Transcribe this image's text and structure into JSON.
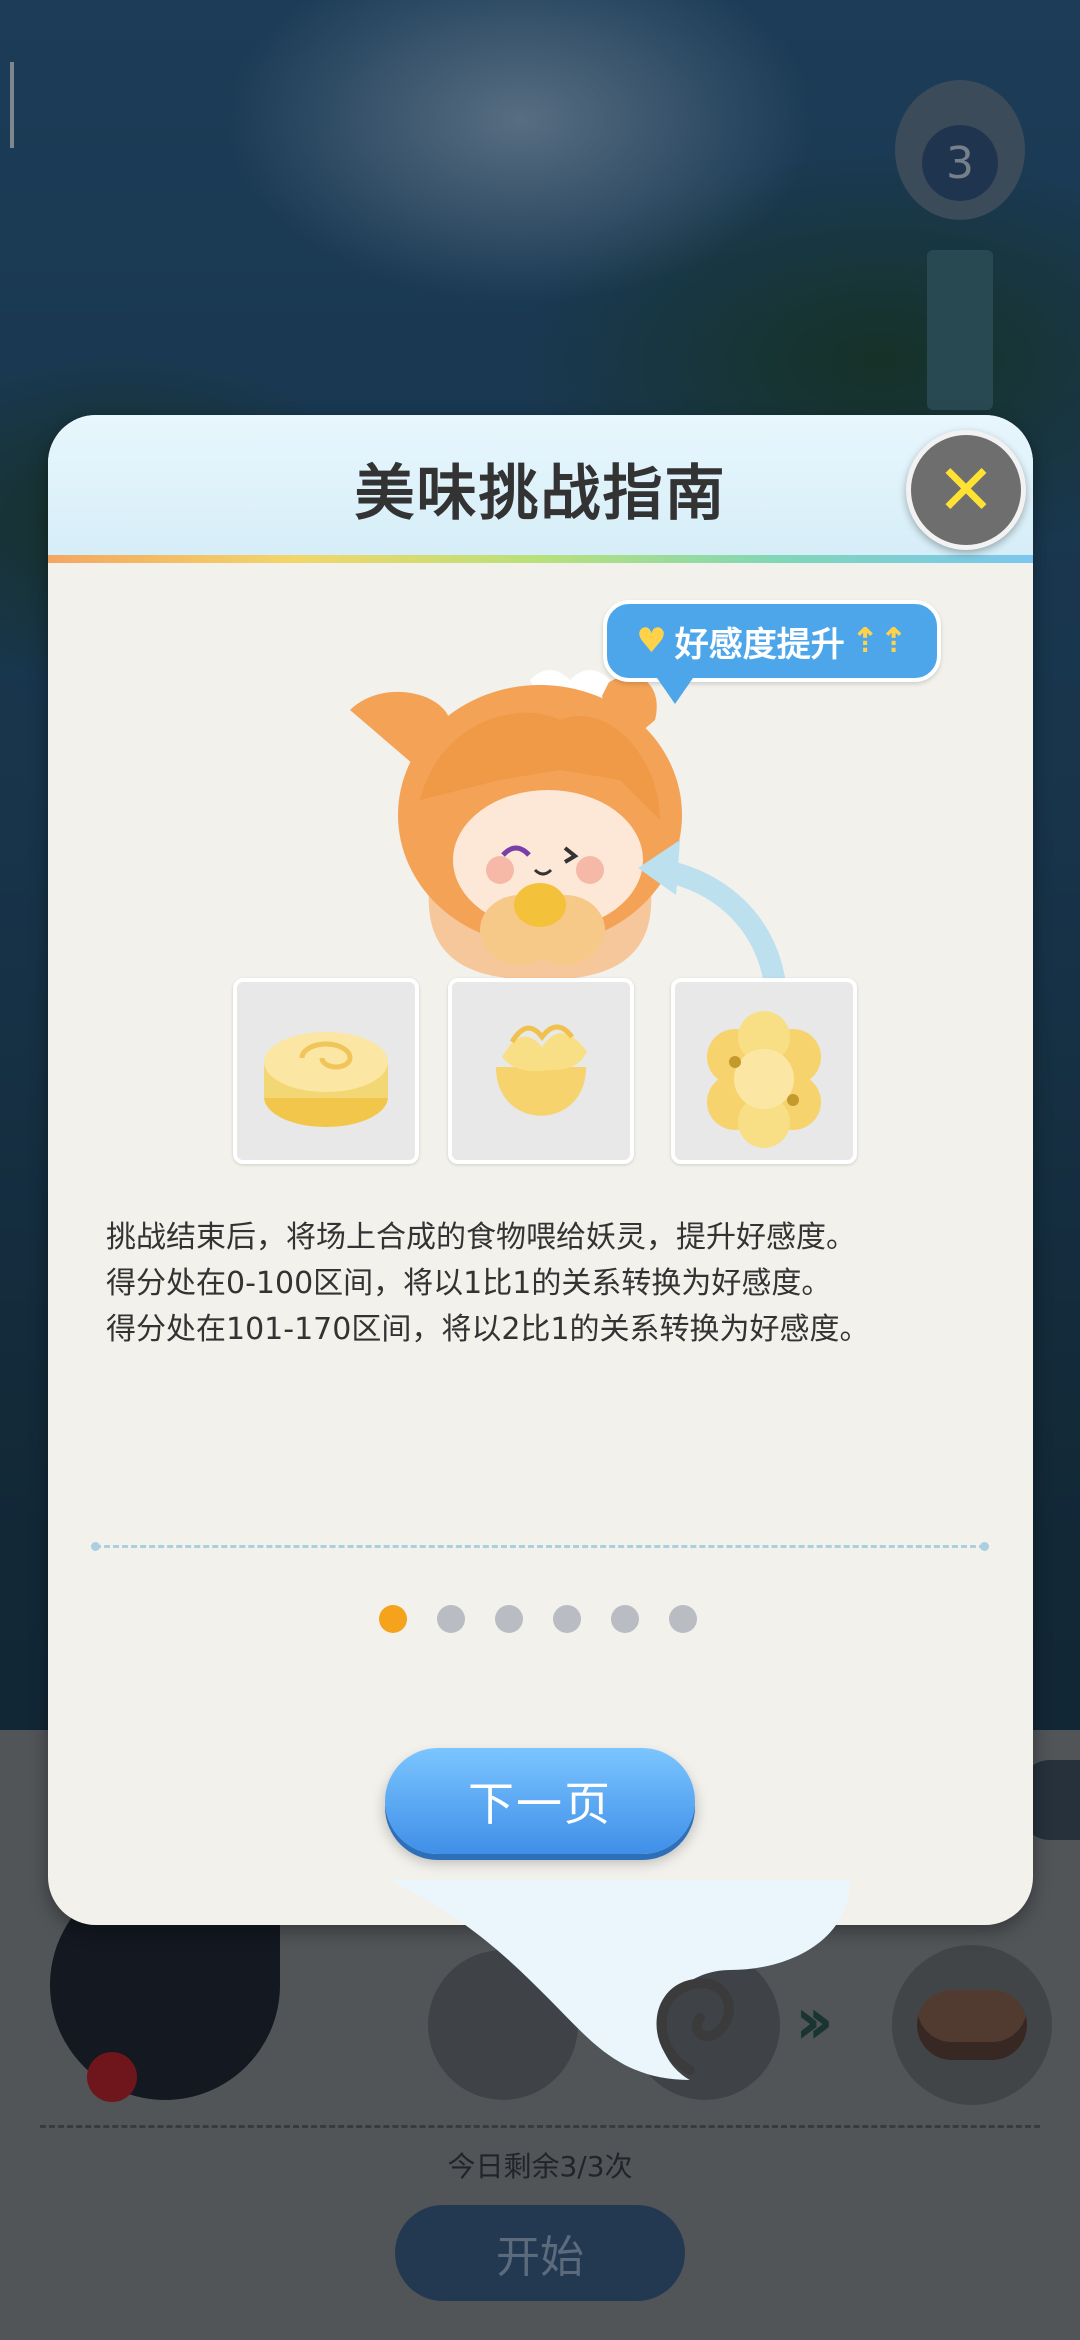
{
  "dialog": {
    "title": "美味挑战指南",
    "bubble_text": "好感度提升",
    "description": [
      "挑战结束后，将场上合成的食物喂给妖灵，提升好感度。",
      "得分处在0-100区间，将以1比1的关系转换为好感度。",
      "得分处在101-170区间，将以2比1的关系转换为好感度。"
    ],
    "foods": [
      "layered-cake",
      "steamed-bun",
      "golden-flower-pastry"
    ],
    "pagination": {
      "total": 6,
      "current": 1
    },
    "next_button": "下一页",
    "close_icon": "close-icon"
  },
  "background": {
    "lantern_number": "3",
    "remaining_text": "今日剩余3/3次",
    "start_button": "开始"
  },
  "colors": {
    "accent_blue": "#4ea6ea",
    "active_dot": "#f5a31c",
    "close_x": "#ffe234"
  }
}
